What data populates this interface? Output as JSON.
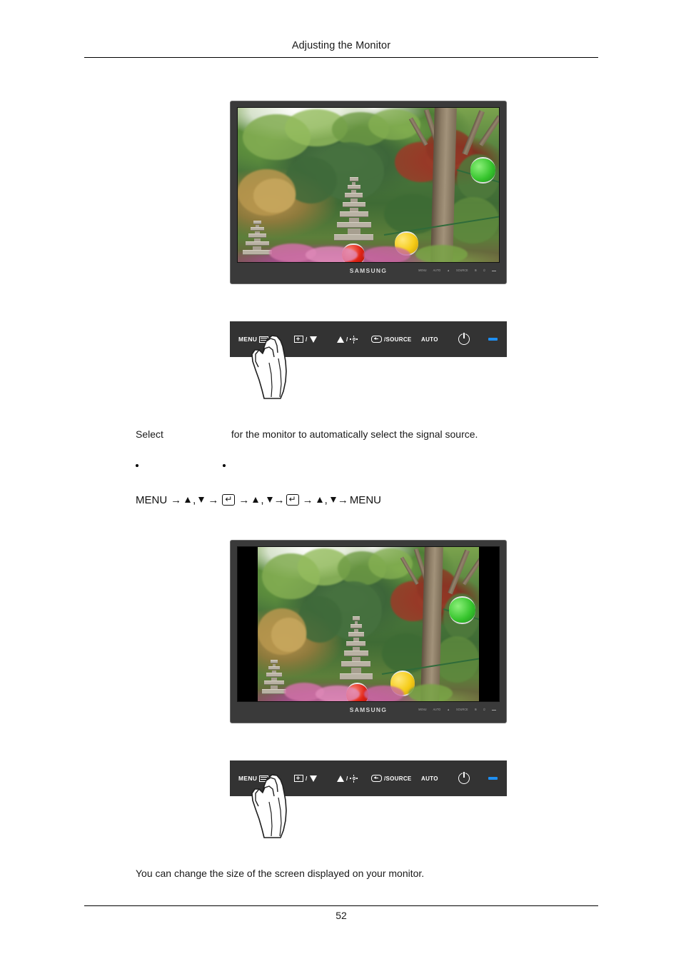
{
  "document": {
    "header_title": "Adjusting the Monitor",
    "page_number": "52"
  },
  "monitors": [
    {
      "id": "monitor-widescreen",
      "brand_logo": "SAMSUNG",
      "aspect_mode": "wide",
      "bezel_buttons": [
        "MENU",
        "AUTO",
        "▲",
        "SOURCE",
        "⊞",
        "⏻",
        "—"
      ]
    },
    {
      "id": "monitor-fourthree",
      "brand_logo": "SAMSUNG",
      "aspect_mode": "4:3",
      "bezel_buttons": [
        "MENU",
        "AUTO",
        "▲",
        "SOURCE",
        "⊞",
        "⏻",
        "—"
      ]
    }
  ],
  "control_panel": {
    "menu_label": "MENU",
    "plus_down_label": "/",
    "up_bright_label": "/",
    "source_label": "/SOURCE",
    "auto_label": "AUTO",
    "power_label": "",
    "led_color": "#1f8ff2",
    "panel_color": "#333333",
    "icons": {
      "menu": "menu-icon",
      "plus": "plus-icon",
      "down": "triangle-down-icon",
      "up": "triangle-up-icon",
      "brightness": "brightness-sun-icon",
      "source": "source-icon",
      "power": "power-icon",
      "led": "power-led-indicator"
    }
  },
  "text": {
    "select_prefix": "Select",
    "select_term": "",
    "select_suffix": "for the monitor to automatically select the signal source.",
    "bullet_one": "",
    "bullet_two": "",
    "nav": {
      "start": "MENU",
      "arrow": "→",
      "comma": ",",
      "enter_glyph": "↵",
      "end": "MENU"
    },
    "closing_paragraph": "You can change the size of the screen displayed on your monitor."
  }
}
